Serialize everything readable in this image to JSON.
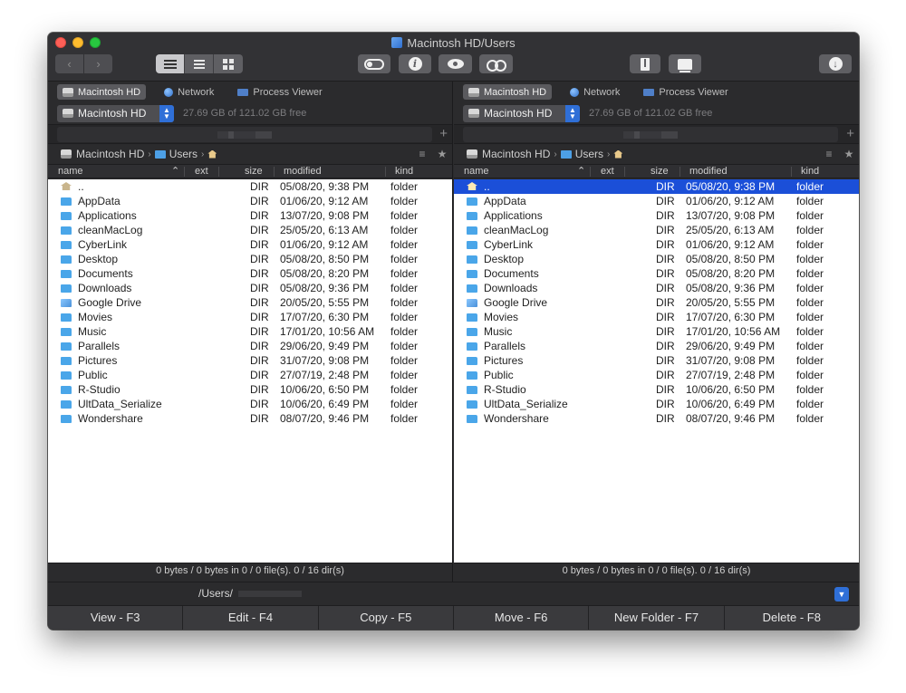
{
  "window": {
    "title": "Macintosh HD/Users"
  },
  "toolbar": {
    "back_icon": "chevron-left-icon",
    "forward_icon": "chevron-right-icon",
    "view_modes": [
      "list-view-icon",
      "detail-view-icon",
      "grid-view-icon"
    ],
    "tools": [
      "toggle-hidden-icon",
      "info-icon",
      "preview-eye-icon",
      "binoculars-search-icon",
      "archive-icon",
      "share-icon",
      "download-icon"
    ]
  },
  "sources": [
    {
      "label": "Macintosh HD",
      "icon": "hard-drive-icon",
      "active": true
    },
    {
      "label": "Network",
      "icon": "globe-icon",
      "active": false
    },
    {
      "label": "Process Viewer",
      "icon": "monitor-icon",
      "active": false
    }
  ],
  "volume": {
    "name": "Macintosh HD",
    "free": "27.69 GB of 121.02 GB free"
  },
  "path": {
    "root": "Macintosh HD",
    "folder": "Users"
  },
  "columns": {
    "name": "name",
    "ext": "ext",
    "size": "size",
    "modified": "modified",
    "kind": "kind"
  },
  "files": [
    {
      "name": "..",
      "size": "DIR",
      "modified": "05/08/20, 9:38 PM",
      "kind": "folder",
      "icon": "parent-folder-icon"
    },
    {
      "name": "AppData",
      "size": "DIR",
      "modified": "01/06/20, 9:12 AM",
      "kind": "folder",
      "icon": "folder-icon"
    },
    {
      "name": "Applications",
      "size": "DIR",
      "modified": "13/07/20, 9:08 PM",
      "kind": "folder",
      "icon": "folder-icon"
    },
    {
      "name": "cleanMacLog",
      "size": "DIR",
      "modified": "25/05/20, 6:13 AM",
      "kind": "folder",
      "icon": "folder-icon"
    },
    {
      "name": "CyberLink",
      "size": "DIR",
      "modified": "01/06/20, 9:12 AM",
      "kind": "folder",
      "icon": "folder-icon"
    },
    {
      "name": "Desktop",
      "size": "DIR",
      "modified": "05/08/20, 8:50 PM",
      "kind": "folder",
      "icon": "folder-icon"
    },
    {
      "name": "Documents",
      "size": "DIR",
      "modified": "05/08/20, 8:20 PM",
      "kind": "folder",
      "icon": "folder-icon"
    },
    {
      "name": "Downloads",
      "size": "DIR",
      "modified": "05/08/20, 9:36 PM",
      "kind": "folder",
      "icon": "folder-icon"
    },
    {
      "name": "Google Drive",
      "size": "DIR",
      "modified": "20/05/20, 5:55 PM",
      "kind": "folder",
      "icon": "google-drive-folder-icon"
    },
    {
      "name": "Movies",
      "size": "DIR",
      "modified": "17/07/20, 6:30 PM",
      "kind": "folder",
      "icon": "folder-icon"
    },
    {
      "name": "Music",
      "size": "DIR",
      "modified": "17/01/20, 10:56 AM",
      "kind": "folder",
      "icon": "folder-icon"
    },
    {
      "name": "Parallels",
      "size": "DIR",
      "modified": "29/06/20, 9:49 PM",
      "kind": "folder",
      "icon": "folder-icon"
    },
    {
      "name": "Pictures",
      "size": "DIR",
      "modified": "31/07/20, 9:08 PM",
      "kind": "folder",
      "icon": "folder-icon"
    },
    {
      "name": "Public",
      "size": "DIR",
      "modified": "27/07/19, 2:48 PM",
      "kind": "folder",
      "icon": "folder-icon"
    },
    {
      "name": "R-Studio",
      "size": "DIR",
      "modified": "10/06/20, 6:50 PM",
      "kind": "folder",
      "icon": "folder-icon"
    },
    {
      "name": "UltData_Serialize",
      "size": "DIR",
      "modified": "10/06/20, 6:49 PM",
      "kind": "folder",
      "icon": "folder-icon"
    },
    {
      "name": "Wondershare",
      "size": "DIR",
      "modified": "08/07/20, 9:46 PM",
      "kind": "folder",
      "icon": "folder-icon"
    }
  ],
  "status": "0 bytes / 0 bytes in 0 / 0 file(s). 0 / 16 dir(s)",
  "cmdline": {
    "path": "/Users/"
  },
  "fkeys": [
    "View - F3",
    "Edit - F4",
    "Copy - F5",
    "Move - F6",
    "New Folder - F7",
    "Delete - F8"
  ],
  "colors": {
    "selection": "#1b4fd8",
    "folder": "#4aa6e9",
    "accent": "#2f6fd7"
  }
}
